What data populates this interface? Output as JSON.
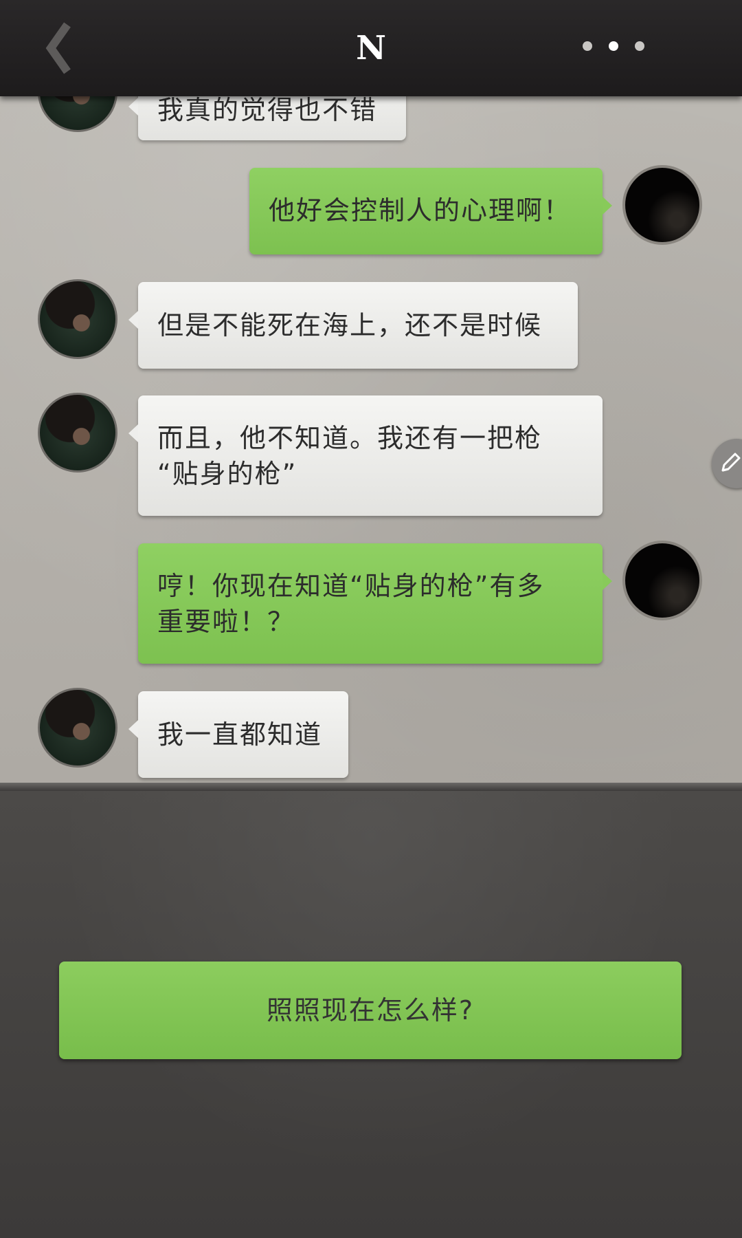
{
  "header": {
    "title": "N",
    "back_icon": "chevron-left-icon",
    "more_icon": "more-dots-icon"
  },
  "messages": [
    {
      "sender": "other",
      "text": "我真的觉得也不错"
    },
    {
      "sender": "me",
      "text": "他好会控制人的心理啊！"
    },
    {
      "sender": "other",
      "text": "但是不能死在海上，还不是时候"
    },
    {
      "sender": "other",
      "line1": "而且，他不知道。我还有一把枪",
      "line2": "“贴身的枪”"
    },
    {
      "sender": "me",
      "line1": "哼！你现在知道“贴身的枪”有多",
      "line2": "重要啦！？"
    },
    {
      "sender": "other",
      "text": "我一直都知道"
    }
  ],
  "reply_option": {
    "label": "照照现在怎么样?"
  },
  "colors": {
    "green_bubble": "#86c858",
    "white_bubble": "#eeeeec",
    "topbar": "#222021"
  },
  "edit_icon": "pencil-icon"
}
